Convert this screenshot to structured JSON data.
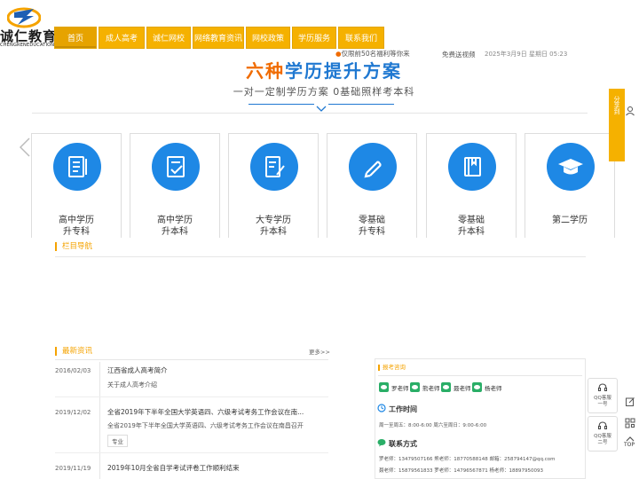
{
  "brand": {
    "name": "诚仁教育",
    "sub": "CHENGRENEDUCATION"
  },
  "nav": [
    {
      "label": "首页",
      "active": true
    },
    {
      "label": "成人高考"
    },
    {
      "label": "诚仁网校"
    },
    {
      "label": "网络教育资讯"
    },
    {
      "label": "网校政策"
    },
    {
      "label": "学历服务"
    },
    {
      "label": "联系我们"
    }
  ],
  "notice": "仅限前50名福利等你来",
  "free_video": "免费送视频",
  "datetime": "2025年3月9日 星期日 05:23",
  "hero": {
    "title_a": "六种",
    "title_b": "学历提升方案",
    "subtitle": "一对一定制学历方案 0基础照样考本科"
  },
  "cards": [
    {
      "l1": "高中学历",
      "l2": "升专科",
      "icon": "document-list-icon"
    },
    {
      "l1": "高中学历",
      "l2": "升本科",
      "icon": "checklist-icon"
    },
    {
      "l1": "大专学历",
      "l2": "升本科",
      "icon": "edit-document-icon"
    },
    {
      "l1": "零基础",
      "l2": "升专科",
      "icon": "pencil-icon"
    },
    {
      "l1": "零基础",
      "l2": "升本科",
      "icon": "book-icon"
    },
    {
      "l1": "第二学历",
      "l2": "",
      "icon": "graduation-cap-icon"
    }
  ],
  "column_nav": "栏目导航",
  "latest_news": {
    "title": "最新资讯",
    "more": "更多>>"
  },
  "news": [
    {
      "date": "2016/02/03",
      "title": "江西省成人高考简介",
      "desc": "关于成人高考介绍",
      "tag": ""
    },
    {
      "date": "2019/12/02",
      "title": "全省2019年下半年全国大学英语四、六级考试考务工作会议在南...",
      "desc": "全省2019年下半年全国大学英语四、六级考试考务工作会议在南昌召开",
      "tag": "专业"
    },
    {
      "date": "2019/11/19",
      "title": "2019年10月全省自学考试评卷工作顺利结束",
      "desc": "",
      "tag": ""
    }
  ],
  "consult": {
    "title": "报考咨询",
    "teachers": [
      "罗老师",
      "熊老师",
      "聂老师",
      "杨老师"
    ],
    "hours_title": "工作时间",
    "hours": "周一至周五：8:00-6:00  周六至周日：9:00-6:00",
    "contact_title": "联系方式",
    "contact_line1": "罗老师：13479507166  熊老师：18770588148  邮箱：258794147@qq.com",
    "contact_line2": "聂老师：15879561833  罗老师：14796567871  杨老师：18897950093"
  },
  "share": {
    "label": "分享到"
  },
  "qq": [
    {
      "line1": "QQ客服",
      "line2": "一号"
    },
    {
      "line1": "QQ客服",
      "line2": "二号"
    }
  ],
  "top_label": "TOP",
  "colors": {
    "nav": "#f5b100",
    "accent_blue": "#1e88e5",
    "title_orange": "#f06b00",
    "section_orange": "#f5a300"
  }
}
